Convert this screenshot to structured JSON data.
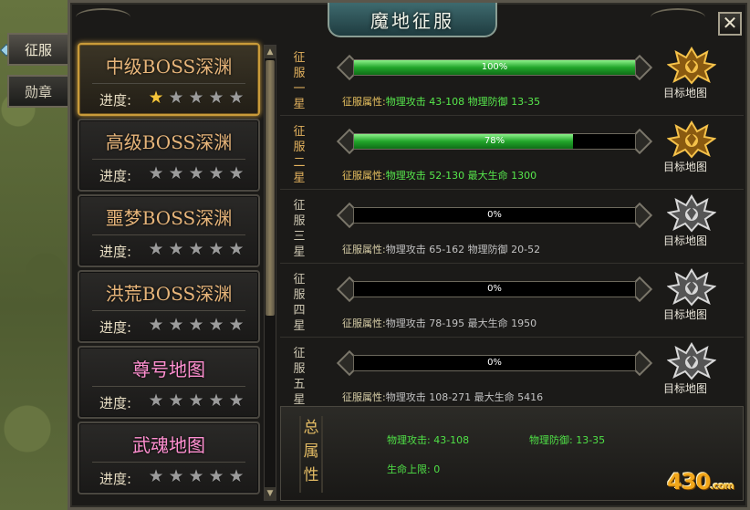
{
  "window": {
    "title": "魔地征服",
    "close_symbol": "✕"
  },
  "side_tabs": [
    {
      "label": "征服",
      "active": true
    },
    {
      "label": "勋章",
      "active": false
    }
  ],
  "map_list": {
    "progress_label": "进度:",
    "items": [
      {
        "name": "中级BOSS深渊",
        "stars_on": 1,
        "stars_total": 5,
        "selected": true,
        "color": "#e7b57a"
      },
      {
        "name": "高级BOSS深渊",
        "stars_on": 0,
        "stars_total": 5,
        "selected": false,
        "color": "#e7b57a"
      },
      {
        "name": "噩梦BOSS深渊",
        "stars_on": 0,
        "stars_total": 5,
        "selected": false,
        "color": "#e7b57a"
      },
      {
        "name": "洪荒BOSS深渊",
        "stars_on": 0,
        "stars_total": 5,
        "selected": false,
        "color": "#e7b57a"
      },
      {
        "name": "尊号地图",
        "stars_on": 0,
        "stars_total": 5,
        "selected": false,
        "color": "#ff8fd0"
      },
      {
        "name": "武魂地图",
        "stars_on": 0,
        "stars_total": 5,
        "selected": false,
        "color": "#ff8fd0"
      }
    ]
  },
  "conquer_rows": [
    {
      "title": "征服一星",
      "progress": 100,
      "progress_text": "100%",
      "attr_label": "征服属性:",
      "attr_text": "物理攻击 43-108  物理防御 13-35",
      "target": "目标地图",
      "active": true
    },
    {
      "title": "征服二星",
      "progress": 78,
      "progress_text": "78%",
      "attr_label": "征服属性:",
      "attr_text": "物理攻击 52-130  最大生命 1300",
      "target": "目标地图",
      "active": true
    },
    {
      "title": "征服三星",
      "progress": 0,
      "progress_text": "0%",
      "attr_label": "征服属性:",
      "attr_text": "物理攻击 65-162  物理防御 20-52",
      "target": "目标地图",
      "active": false
    },
    {
      "title": "征服四星",
      "progress": 0,
      "progress_text": "0%",
      "attr_label": "征服属性:",
      "attr_text": "物理攻击 78-195  最大生命 1950",
      "target": "目标地图",
      "active": false
    },
    {
      "title": "征服五星",
      "progress": 0,
      "progress_text": "0%",
      "attr_label": "征服属性:",
      "attr_text": "物理攻击 108-271  最大生命 5416",
      "target": "目标地图",
      "active": false
    }
  ],
  "total_attributes": {
    "title": "总属性",
    "phys_attack": "物理攻击: 43-108",
    "phys_defense": "物理防御: 13-35",
    "hp_limit": "生命上限: 0"
  },
  "watermark": {
    "main": "430",
    "suffix": ".com"
  },
  "colors": {
    "gold_text": "#e3b25e",
    "green_value": "#57e84c",
    "bar_green": "#21a52a",
    "pink_text": "#ff8fd0"
  }
}
